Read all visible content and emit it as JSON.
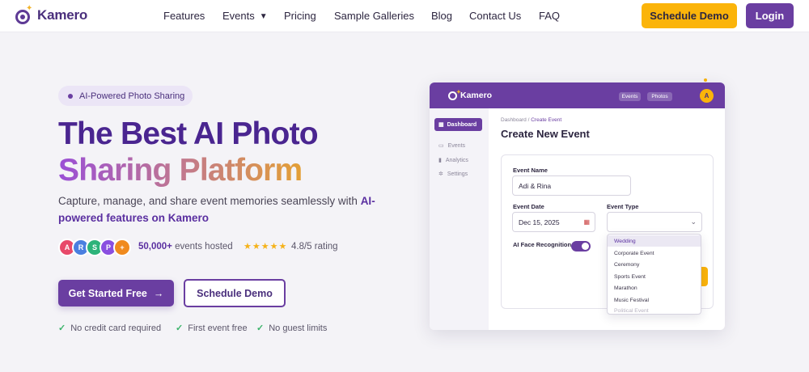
{
  "nav": {
    "brand": "Kamero",
    "links": [
      "Features",
      "Events",
      "Pricing",
      "Sample Galleries",
      "Blog",
      "Contact Us",
      "FAQ"
    ],
    "cta_demo": "Schedule Demo",
    "cta_login": "Login"
  },
  "hero": {
    "badge": "AI-Powered Photo Sharing",
    "title_line1": "The Best AI Photo",
    "title_line2": "Sharing Platform",
    "subtitle_part1": "Capture, manage, and share event memories seamlessly with ",
    "subtitle_bold": "AI-powered features on Kamero",
    "avatars": [
      "A",
      "R",
      "S",
      "P",
      "+"
    ],
    "avatar_colors": [
      "#e8496a",
      "#4a7fe0",
      "#2db37a",
      "#8a4fe0",
      "#f08a1e"
    ],
    "events_count": "50,000+",
    "events_label": "events hosted",
    "stars": "★★★★★",
    "rating": "4.8/5 rating",
    "primary_button": "Get Started Free",
    "secondary_button": "Schedule Demo",
    "checks": [
      "No credit card required",
      "First event free",
      "No guest limits"
    ]
  },
  "mockup": {
    "brand": "Kamero",
    "header_pills": [
      "Events",
      "Photos"
    ],
    "user_initial": "A",
    "sidebar": [
      "Dashboard",
      "Events",
      "Analytics",
      "Settings"
    ],
    "breadcrumb_root": "Dashboard /",
    "breadcrumb_current": "Create Event",
    "title": "Create New Event",
    "event_name_label": "Event Name",
    "event_name_value": "Adi & Rina",
    "event_date_label": "Event Date",
    "event_date_value": "Dec 15, 2025",
    "event_type_label": "Event Type",
    "face_recognition_label": "AI Face Recognition",
    "face_recognition_on": true,
    "event_type_options": [
      "Wedding",
      "Corporate Event",
      "Ceremony",
      "Sports Event",
      "Marathon",
      "Music Festival",
      "Political Event"
    ],
    "event_type_highlighted": "Wedding"
  },
  "colors": {
    "brand_purple": "#6a3ea1",
    "accent_yellow": "#fbb40a",
    "check_green": "#3bb36a"
  }
}
